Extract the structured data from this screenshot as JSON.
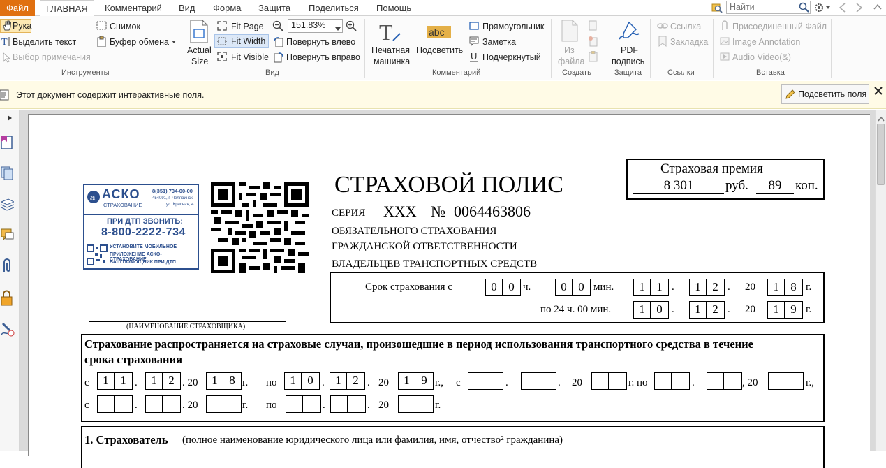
{
  "tabs": {
    "file": "Файл",
    "home": "ГЛАВНАЯ",
    "comment": "Комментарий",
    "view": "Вид",
    "form": "Форма",
    "protect": "Защита",
    "share": "Поделиться",
    "help": "Помощь"
  },
  "search": {
    "placeholder": "Найти"
  },
  "ribbon": {
    "tools": {
      "hand": "Рука",
      "select_text": "Выделить текст",
      "select_annotation": "Выбор примечания",
      "snapshot": "Снимок",
      "clipboard": "Буфер обмена",
      "group": "Инструменты"
    },
    "view": {
      "actual_size_1": "Actual",
      "actual_size_2": "Size",
      "fit_page": "Fit Page",
      "fit_width": "Fit Width",
      "fit_visible": "Fit Visible",
      "zoom": "151.83%",
      "rotate_left": "Повернуть влево",
      "rotate_right": "Повернуть вправо",
      "group": "Вид"
    },
    "comment": {
      "typewriter_1": "Печатная",
      "typewriter_2": "машинка",
      "highlight": "Подсветить",
      "rectangle": "Прямоугольник",
      "note": "Заметка",
      "underline": "Подчеркнутый",
      "group": "Комментарий"
    },
    "create": {
      "from_file_1": "Из",
      "from_file_2": "файла",
      "group": "Создать"
    },
    "protect": {
      "pdf_sign_1": "PDF",
      "pdf_sign_2": "подпись",
      "group": "Защита"
    },
    "links": {
      "link": "Ссылка",
      "bookmark": "Закладка",
      "group": "Ссылки"
    },
    "insert": {
      "attached_file": "Присоединенный Файл",
      "image_annotation": "Image Annotation",
      "audio_video": "Audio  Video(&)",
      "group": "Вставка"
    }
  },
  "notice": {
    "text": "Этот документ содержит интерактивные поля.",
    "highlight_fields": "Подсветить поля"
  },
  "document": {
    "logo": {
      "brand": "АСКО",
      "brand_sub": "СТРАХОВАНИЕ",
      "phone_small": "8(351) 734-00-00",
      "addr1": "454091, г. Челябинск,",
      "addr2": "ул. Красная, 4",
      "call_title": "ПРИ ДТП ЗВОНИТЬ:",
      "call_phone": "8-800-2222-734",
      "app1": "УСТАНОВИТЕ МОБИЛЬНОЕ",
      "app2": "ПРИЛОЖЕНИЕ АСКО-СТРАХОВАНИЕ:",
      "app3": "ВАШ ПОМОЩНИК ПРИ ДТП"
    },
    "insurer_caption": "(НАИМЕНОВАНИЕ СТРАХОВЩИКА)",
    "title": "СТРАХОВОЙ ПОЛИС",
    "series_label": "СЕРИЯ",
    "series": "ХХХ",
    "number_label": "№",
    "number": "0064463806",
    "sub1": "ОБЯЗАТЕЛЬНОГО СТРАХОВАНИЯ",
    "sub2": "ГРАЖДАНСКОЙ ОТВЕТСТВЕННОСТИ",
    "sub3": "ВЛАДЕЛЬЦЕВ ТРАНСПОРТНЫХ СРЕДСТВ",
    "premium": {
      "label": "Страховая   премия",
      "rub": "8 301",
      "rub_label": "руб.",
      "kop": "89",
      "kop_label": "коп."
    },
    "term": {
      "from_label": "Срок страхования с",
      "h": [
        "0",
        "0"
      ],
      "h_label": "ч.",
      "m": [
        "0",
        "0"
      ],
      "m_label": "мин.",
      "d": [
        "1",
        "1"
      ],
      "mo": [
        "1",
        "2"
      ],
      "yr_prefix": "20",
      "y": [
        "1",
        "8"
      ],
      "y_label": "г.",
      "to_label": "по 24 ч. 00 мин.",
      "d2": [
        "1",
        "0"
      ],
      "mo2": [
        "1",
        "2"
      ],
      "y2": [
        "1",
        "9"
      ]
    },
    "usage": {
      "text1": "Страхование распространяется на страховые случаи, произошедшие в период использования транспортного средства в течение",
      "text2": "срока страхования",
      "c": "с",
      "po": "по",
      "g": "г.",
      "g_comma": "г.,",
      "yr": "20",
      "d1": [
        "1",
        "1"
      ],
      "m1": [
        "1",
        "2"
      ],
      "y1": [
        "1",
        "8"
      ],
      "d2": [
        "1",
        "0"
      ],
      "m2": [
        "1",
        "2"
      ],
      "y2": [
        "1",
        "9"
      ],
      "gpo": "г. по"
    },
    "insured": {
      "num": "1. Страхователь",
      "desc": "(полное наименование юридического лица или фамилия, имя, отчество² гражданина)"
    }
  }
}
